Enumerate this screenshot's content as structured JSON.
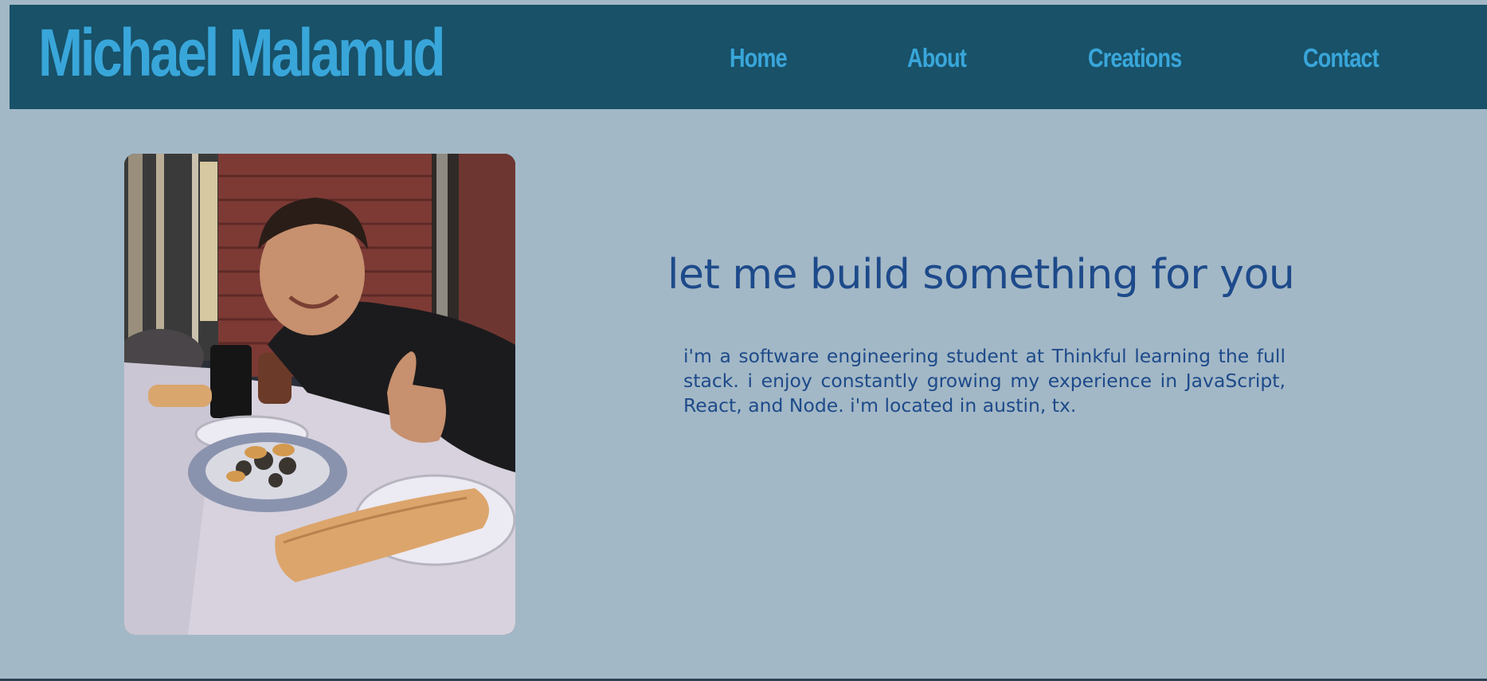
{
  "header": {
    "site_title": "Michael Malamud",
    "nav": [
      {
        "label": "Home"
      },
      {
        "label": "About"
      },
      {
        "label": "Creations"
      },
      {
        "label": "Contact"
      }
    ]
  },
  "main": {
    "headline": "let me build something for you",
    "bio": "i'm a software engineering student at Thinkful learning the full stack. i enjoy constantly growing my experience in JavaScript, React, and Node. i'm located in austin, tx."
  },
  "colors": {
    "page_background": "#a3b8c6",
    "header_background": "#185168",
    "header_text": "#39a6da",
    "body_text": "#1d4a8a"
  }
}
